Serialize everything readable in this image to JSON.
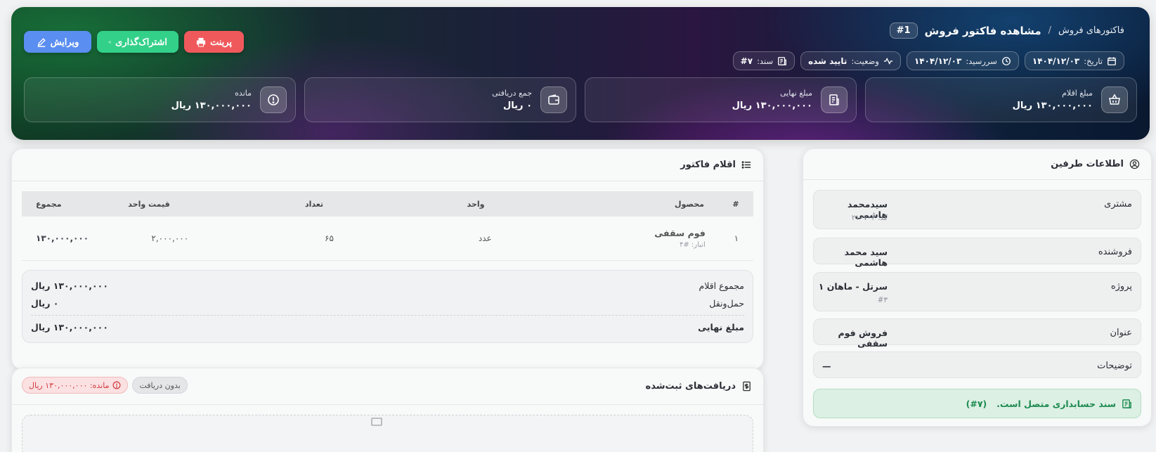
{
  "hero": {
    "breadcrumb_link": "فاکتورهای فروش",
    "breadcrumb_sep": "/",
    "title": "مشاهده فاکتور فروش",
    "id_badge": "#1",
    "meta": {
      "date_label": "تاریخ:",
      "date_value": "۱۴۰۴/۱۲/۰۳",
      "due_label": "سررسید:",
      "due_value": "۱۴۰۴/۱۲/۰۳",
      "status_label": "وضعیت:",
      "status_value": "تایید شده",
      "doc_label": "سند:",
      "doc_value": "#۷"
    },
    "actions": {
      "edit": "ویرایش",
      "share": "اشتراک‌گذاری",
      "print": "پرینت"
    },
    "stats": [
      {
        "label": "مبلغ اقلام",
        "value": "۱۳۰,۰۰۰,۰۰۰ ریال",
        "icon": "basket-icon"
      },
      {
        "label": "مبلغ نهایی",
        "value": "۱۳۰,۰۰۰,۰۰۰ ریال",
        "icon": "receipt-icon"
      },
      {
        "label": "جمع دریافتی",
        "value": "۰ ریال",
        "icon": "wallet-icon"
      },
      {
        "label": "مانده",
        "value": "۱۳۰,۰۰۰,۰۰۰ ریال",
        "icon": "alert-icon"
      }
    ]
  },
  "parties": {
    "title": "اطلاعات طرفین",
    "customer_label": "مشتری",
    "customer_value": "سیدمحمد هاشمی",
    "customer_sub": "کد: ۲۱۰۷۰۳",
    "seller_label": "فروشنده",
    "seller_value": "سید محمد هاشمی",
    "project_label": "پروژه",
    "project_value": "سرتل - ماهان ۱",
    "project_sub": "#۳",
    "subject_label": "عنوان",
    "subject_value": "فروش فوم سقفی",
    "notes_label": "توضیحات",
    "notes_value": "—",
    "linked_text": "سند حسابداری متصل است.",
    "linked_ref": "(#۷)"
  },
  "items": {
    "title": "اقلام فاکتور",
    "headers": {
      "idx": "#",
      "product": "محصول",
      "unit": "واحد",
      "qty": "تعداد",
      "price": "قیمت واحد",
      "total": "مجموع"
    },
    "rows": [
      {
        "idx": "۱",
        "product": "فوم سقفی",
        "warehouse": "انبار: #۴",
        "unit": "عدد",
        "qty": "۶۵",
        "price": "۲,۰۰۰,۰۰۰",
        "total": "۱۳۰,۰۰۰,۰۰۰"
      }
    ],
    "totals": {
      "items_label": "مجموع اقلام",
      "items_value": "۱۳۰,۰۰۰,۰۰۰ ریال",
      "shipping_label": "حمل‌ونقل",
      "shipping_value": "۰ ریال",
      "final_label": "مبلغ نهایی",
      "final_value": "۱۳۰,۰۰۰,۰۰۰ ریال"
    }
  },
  "payments": {
    "title": "دریافت‌های ثبت‌شده",
    "badge_none": "بدون دریافت",
    "badge_remaining": "مانده: ۱۳۰,۰۰۰,۰۰۰ ریال"
  }
}
